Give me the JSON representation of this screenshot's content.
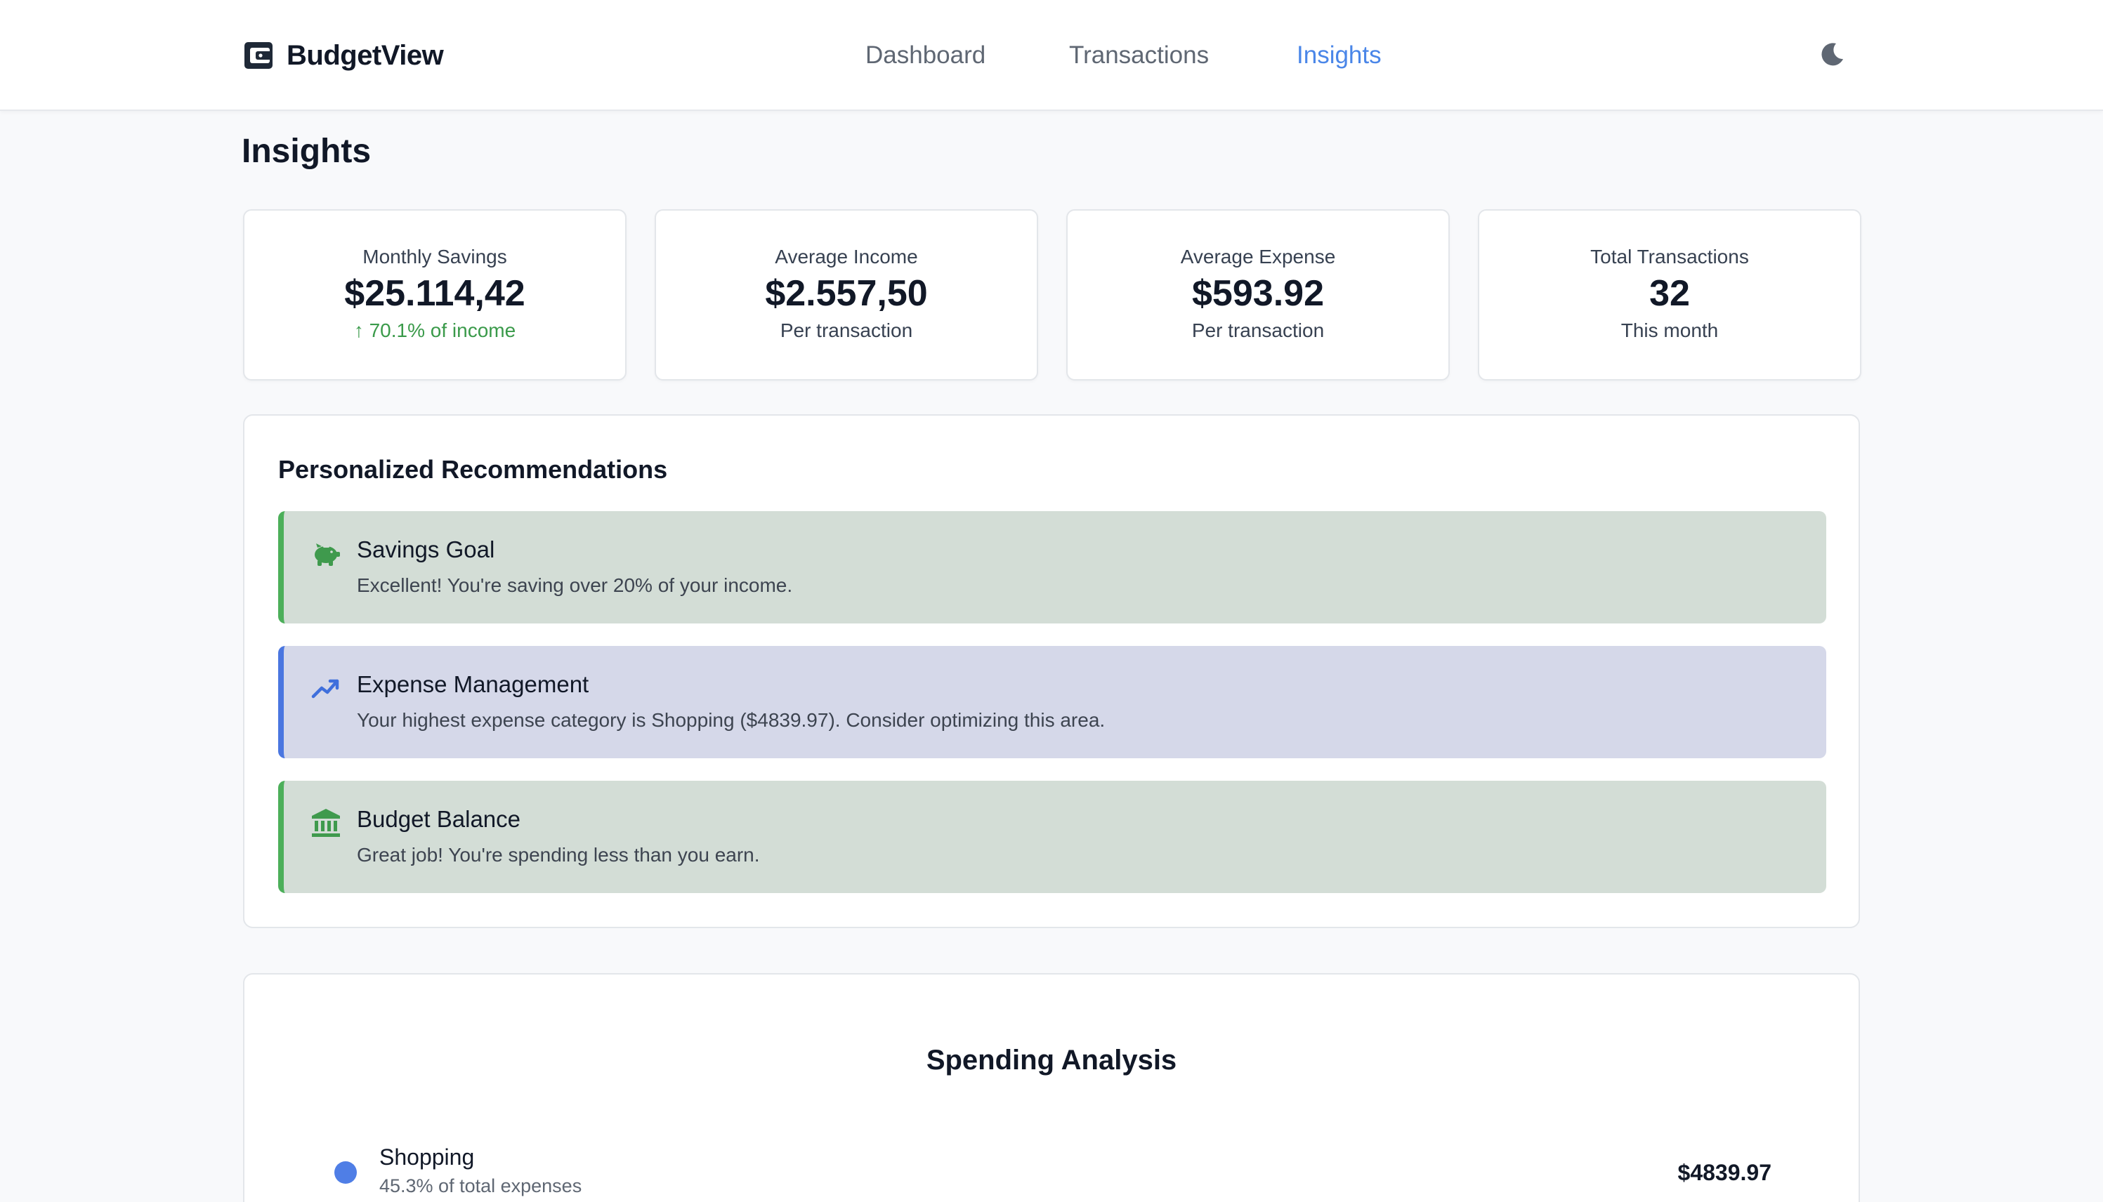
{
  "app": {
    "name": "BudgetView"
  },
  "nav": {
    "items": [
      {
        "label": "Dashboard",
        "active": false
      },
      {
        "label": "Transactions",
        "active": false
      },
      {
        "label": "Insights",
        "active": true
      }
    ],
    "theme_icon": "moon-icon"
  },
  "page": {
    "title": "Insights"
  },
  "stats": [
    {
      "label": "Monthly Savings",
      "value": "$25.114,42",
      "sub": "↑ 70.1% of income",
      "sub_color": "#3a9a4a"
    },
    {
      "label": "Average Income",
      "value": "$2.557,50",
      "sub": "Per transaction"
    },
    {
      "label": "Average Expense",
      "value": "$593.92",
      "sub": "Per transaction"
    },
    {
      "label": "Total Transactions",
      "value": "32",
      "sub": "This month"
    }
  ],
  "recommendations": {
    "title": "Personalized Recommendations",
    "items": [
      {
        "icon": "piggy-bank-icon",
        "title": "Savings Goal",
        "description": "Excellent! You're saving over 20% of your income.",
        "tone": "green"
      },
      {
        "icon": "trending-up-icon",
        "title": "Expense Management",
        "description": "Your highest expense category is Shopping ($4839.97). Consider optimizing this area.",
        "tone": "blue"
      },
      {
        "icon": "bank-icon",
        "title": "Budget Balance",
        "description": "Great job! You're spending less than you earn.",
        "tone": "green"
      }
    ]
  },
  "spending": {
    "title": "Spending Analysis",
    "categories": [
      {
        "name": "Shopping",
        "percent_text": "45.3% of total expenses",
        "amount": "$4839.97",
        "color": "#4f7ee6"
      }
    ]
  },
  "colors": {
    "accent": "#4a86e8",
    "positive": "#3a9a4a",
    "reco_green_bg": "#d3ddd6",
    "reco_green_border": "#4caf5a",
    "reco_blue_bg": "#d5d8e9",
    "reco_blue_border": "#4a76e0"
  }
}
